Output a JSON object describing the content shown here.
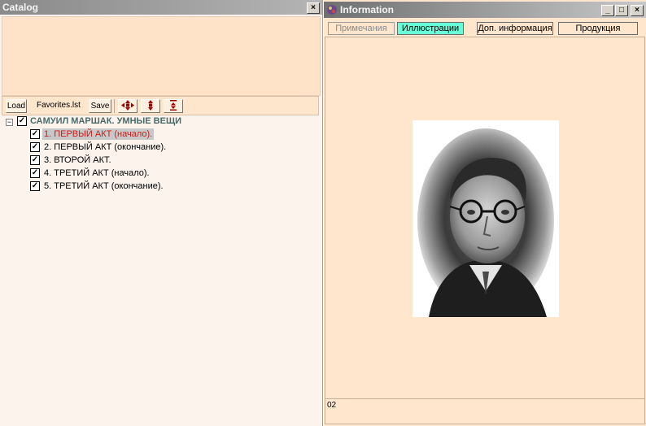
{
  "catalog": {
    "title": "Catalog",
    "close_label": "×",
    "toolbar": {
      "load_label": "Load",
      "file_name": "Favorites.lst",
      "save_label": "Save"
    },
    "tree": {
      "root": {
        "label": "САМУИЛ МАРШАК. УМНЫЕ ВЕЩИ",
        "checked": true
      },
      "items": [
        {
          "label": "1. ПЕРВЫЙ АКТ (начало).",
          "checked": true,
          "selected": true
        },
        {
          "label": "2. ПЕРВЫЙ АКТ (окончание).",
          "checked": true
        },
        {
          "label": "3. ВТОРОЙ АКТ.",
          "checked": true
        },
        {
          "label": "4. ТРЕТИЙ АКТ (начало).",
          "checked": true
        },
        {
          "label": "5. ТРЕТИЙ АКТ (окончание).",
          "checked": true
        }
      ]
    }
  },
  "information": {
    "title": "Information",
    "tabs": [
      {
        "label": "Примечания",
        "state": "inactive"
      },
      {
        "label": "Иллюстрации",
        "state": "active"
      },
      {
        "label": "Доп. информация",
        "state": "normal"
      },
      {
        "label": "Продукция",
        "state": "normal"
      }
    ],
    "status_text": "02"
  },
  "colors": {
    "selected_text": "#d01818",
    "active_tab": "#66ffd8",
    "panel_bg": "#ffe6cc"
  }
}
